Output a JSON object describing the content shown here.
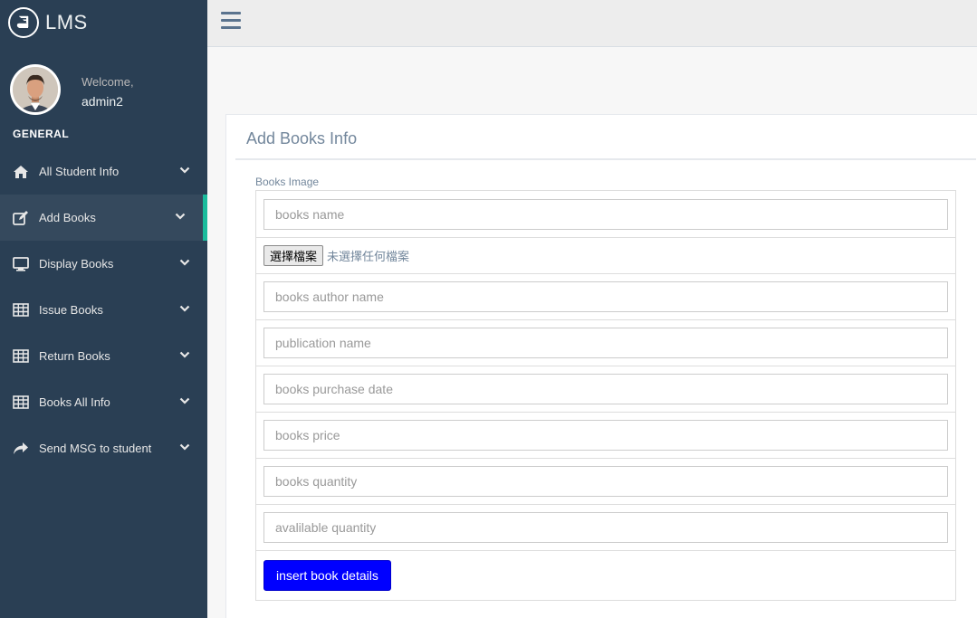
{
  "brand": {
    "title": "LMS",
    "icon": "book-icon"
  },
  "profile": {
    "welcome": "Welcome,",
    "username": "admin2"
  },
  "sidebar": {
    "section_title": "GENERAL",
    "items": [
      {
        "label": "All Student Info",
        "icon": "home-icon"
      },
      {
        "label": "Add Books",
        "icon": "edit-icon",
        "active": true
      },
      {
        "label": "Display Books",
        "icon": "desktop-icon"
      },
      {
        "label": "Issue Books",
        "icon": "table-icon"
      },
      {
        "label": "Return Books",
        "icon": "table-icon"
      },
      {
        "label": "Books All Info",
        "icon": "table-icon"
      },
      {
        "label": "Send MSG to student",
        "icon": "share-icon"
      }
    ]
  },
  "panel": {
    "title": "Add Books Info",
    "image_label": "Books Image"
  },
  "form": {
    "books_name_placeholder": "books name",
    "file_button": "選擇檔案",
    "file_status": "未選擇任何檔案",
    "author_placeholder": "books author name",
    "publication_placeholder": "publication name",
    "purchase_date_placeholder": "books purchase date",
    "price_placeholder": "books price",
    "quantity_placeholder": "books quantity",
    "available_placeholder": "avalilable quantity",
    "submit_label": "insert book details"
  },
  "colors": {
    "sidebar_bg": "#2a3f54",
    "active_accent": "#1abb9c",
    "submit_bg": "#0000ff"
  }
}
